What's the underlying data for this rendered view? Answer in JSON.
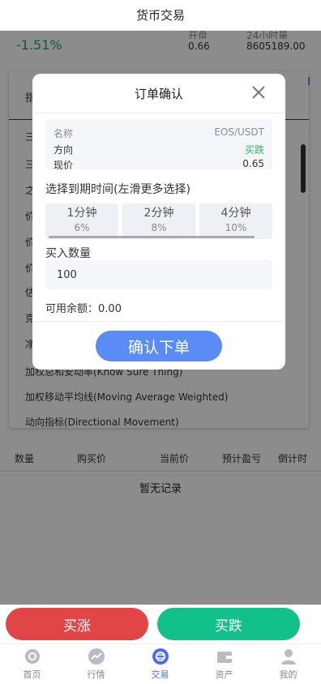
{
  "header": {
    "title": "货币交易"
  },
  "quote": {
    "change_pct": "-1.51%",
    "open_label": "开盘",
    "open_value": "0.66",
    "volume_label": "24小时量",
    "volume_value": "8605189.00"
  },
  "strategy_card": {
    "header_partial": "指",
    "rows_partial": [
      "三",
      "三",
      "之",
      "价",
      "价",
      "价",
      "估",
      "克",
      "净"
    ],
    "rows": [
      "加权总和安动率(Know Sure Thing)",
      "加权移动平均线(Moving Average Weighted)",
      "动向指标(Directional Movement)"
    ]
  },
  "orders_table": {
    "columns": [
      "数量",
      "购买价",
      "当前价",
      "预计盈亏",
      "倒计时"
    ],
    "empty_text": "暂无记录"
  },
  "actions": {
    "buy_up": "买涨",
    "buy_down": "买跌"
  },
  "tabbar": {
    "items": [
      {
        "label": "首页",
        "icon": "home-icon"
      },
      {
        "label": "行情",
        "icon": "market-icon"
      },
      {
        "label": "交易",
        "icon": "trade-icon",
        "active": true
      },
      {
        "label": "资产",
        "icon": "wallet-icon"
      },
      {
        "label": "我的",
        "icon": "user-icon"
      }
    ]
  },
  "modal": {
    "title": "订单确认",
    "info": {
      "name_label": "名称",
      "name_value": "EOS/USDT",
      "direction_label": "方向",
      "direction_value": "买跌",
      "price_label": "现价",
      "price_value": "0.65"
    },
    "period_label": "选择到期时间(左滑更多选择)",
    "periods": [
      {
        "time": "1分钟",
        "rate": "6%"
      },
      {
        "time": "2分钟",
        "rate": "8%"
      },
      {
        "time": "4分钟",
        "rate": "10%"
      }
    ],
    "quantity_label": "买入数量",
    "quantity_value": "100",
    "available_label": "可用余额：",
    "available_value": "0.00",
    "confirm_label": "确认下单"
  },
  "colors": {
    "up": "#e24546",
    "down": "#12c089",
    "accent": "#5b8cf5",
    "green_text": "#2fb45a"
  }
}
